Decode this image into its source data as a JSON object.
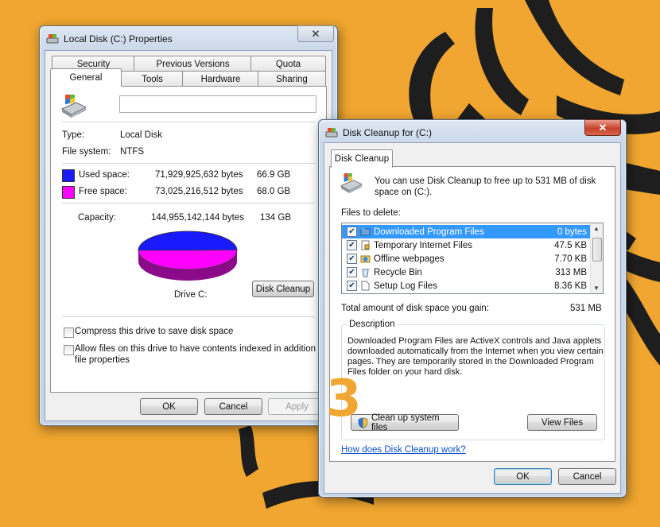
{
  "colors": {
    "background": "#f0a630",
    "used_space": "#1a1aff",
    "free_space": "#ff00ff",
    "selection": "#3399ff"
  },
  "properties": {
    "title": "Local Disk (C:) Properties",
    "close_glyph": "✕",
    "tabs_top": [
      "Security",
      "Previous Versions",
      "Quota"
    ],
    "tabs_bottom": [
      "General",
      "Tools",
      "Hardware",
      "Sharing"
    ],
    "active_tab": "General",
    "name_value": "",
    "type_label": "Type:",
    "type_value": "Local Disk",
    "fs_label": "File system:",
    "fs_value": "NTFS",
    "used_label": "Used space:",
    "used_bytes": "71,929,925,632 bytes",
    "used_gb": "66.9 GB",
    "free_label": "Free space:",
    "free_bytes": "73,025,216,512 bytes",
    "free_gb": "68.0 GB",
    "capacity_label": "Capacity:",
    "capacity_bytes": "144,955,142,144 bytes",
    "capacity_gb": "134 GB",
    "used_fraction": 0.496,
    "drive_label": "Drive C:",
    "disk_cleanup_button": "Disk Cleanup",
    "compress_label": "Compress this drive to save disk space",
    "index_label_line1": "Allow files on this drive to have contents indexed in addition to",
    "index_label_line2": "file properties",
    "ok": "OK",
    "cancel": "Cancel",
    "apply": "Apply"
  },
  "cleanup": {
    "title": "Disk Cleanup for  (C:)",
    "close_glyph": "✕",
    "tab": "Disk Cleanup",
    "intro_line1": "You can use Disk Cleanup to free up to 531 MB of disk",
    "intro_line2": "space on  (C:).",
    "files_to_delete": "Files to delete:",
    "files": [
      {
        "name": "Downloaded Program Files",
        "size": "0 bytes",
        "checked": true,
        "selected": true,
        "icon": "folder-icon"
      },
      {
        "name": "Temporary Internet Files",
        "size": "47.5 KB",
        "checked": true,
        "selected": false,
        "icon": "lock-file-icon"
      },
      {
        "name": "Offline webpages",
        "size": "7.70 KB",
        "checked": true,
        "selected": false,
        "icon": "web-folder-icon"
      },
      {
        "name": "Recycle Bin",
        "size": "313 MB",
        "checked": true,
        "selected": false,
        "icon": "recycle-bin-icon"
      },
      {
        "name": "Setup Log Files",
        "size": "8.36 KB",
        "checked": true,
        "selected": false,
        "icon": "file-icon"
      }
    ],
    "total_label": "Total amount of disk space you gain:",
    "total_value": "531 MB",
    "description_heading": "Description",
    "description_lines": [
      "Downloaded Program Files are ActiveX controls and Java applets",
      "downloaded automatically from the Internet when you view certain",
      "pages. They are temporarily stored in the Downloaded Program",
      "Files folder on your hard disk."
    ],
    "cleanup_system_button": "Clean up system files",
    "view_files_button": "View Files",
    "help_link": "How does Disk Cleanup work?",
    "ok": "OK",
    "cancel": "Cancel",
    "step_number": "3"
  }
}
